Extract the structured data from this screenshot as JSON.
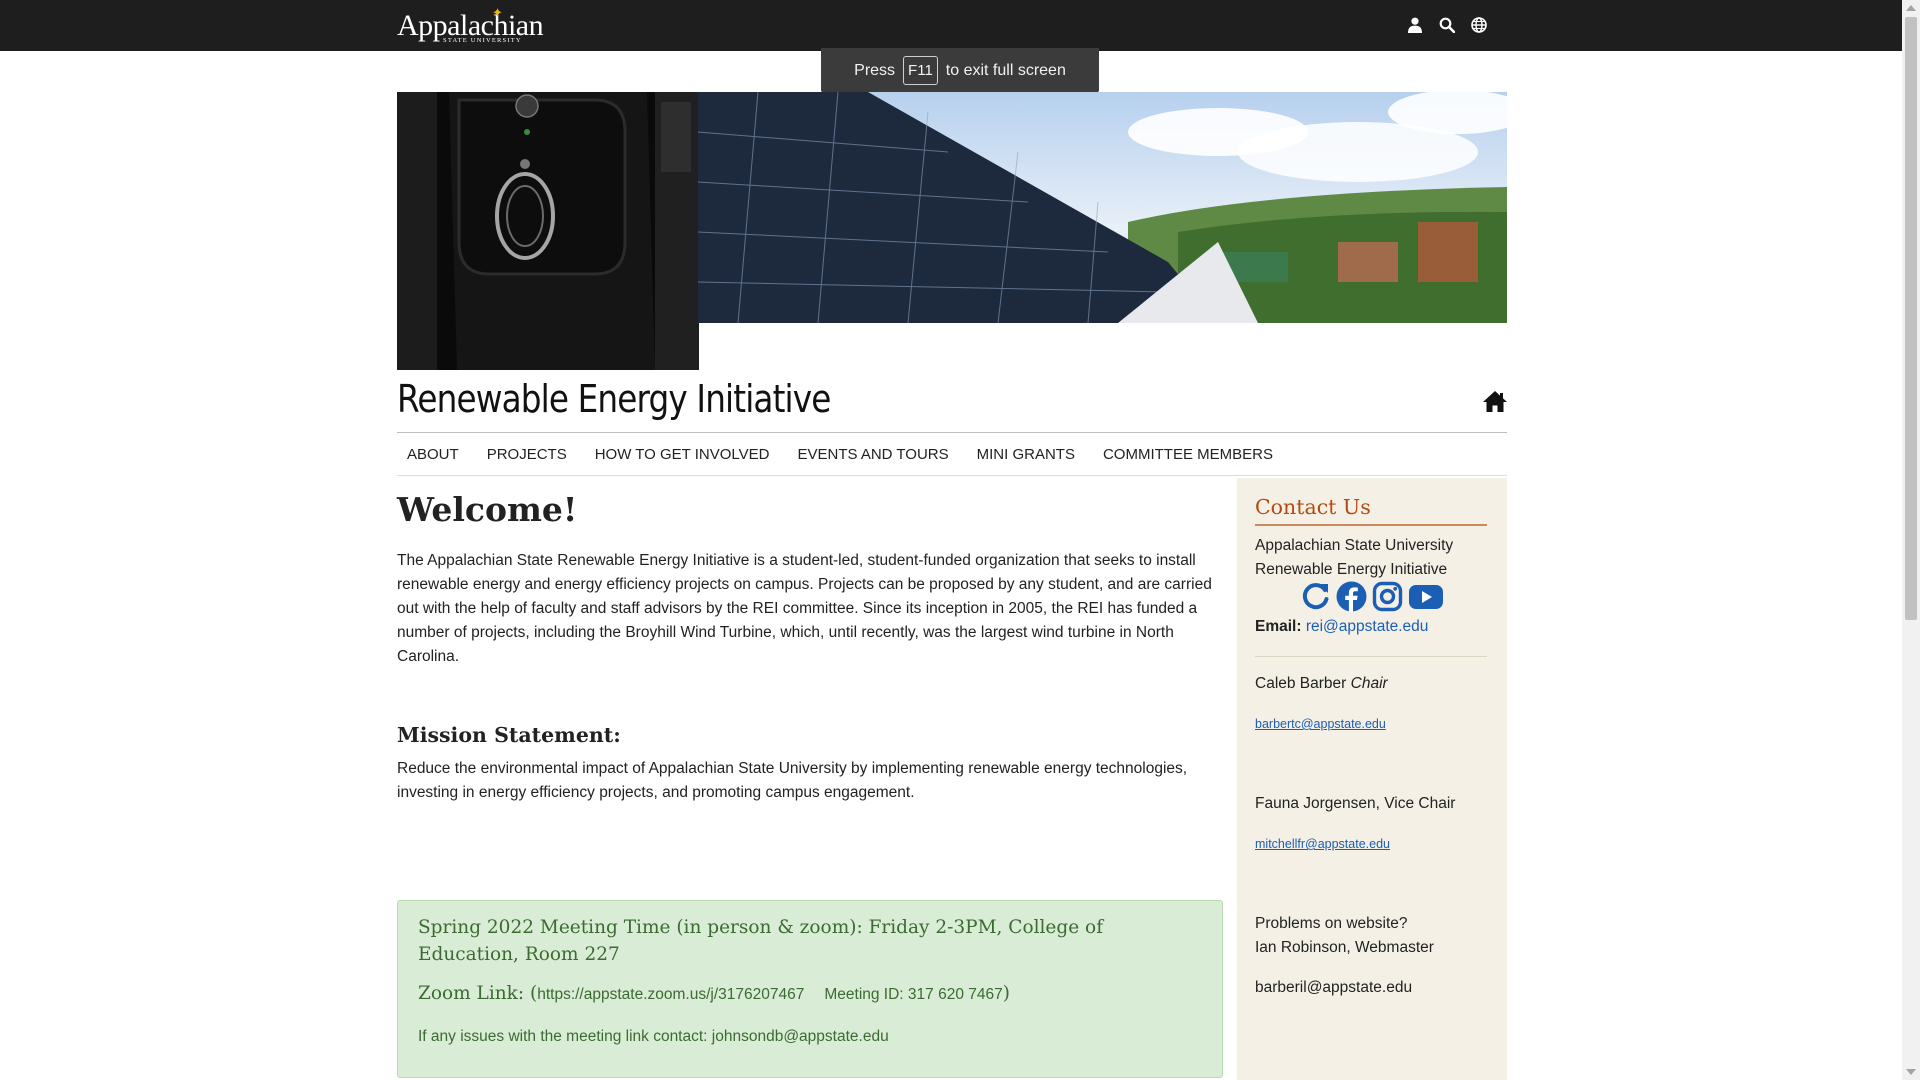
{
  "topbar": {
    "logo_text": "Appalachian",
    "logo_subtext": "STATE UNIVERSITY",
    "icons": [
      "user-icon",
      "search-icon",
      "globe-icon"
    ]
  },
  "fullscreen_notice": {
    "before": "Press",
    "key": "F11",
    "after": "to exit full screen"
  },
  "site": {
    "title": "Renewable Energy Initiative"
  },
  "nav": {
    "items": [
      "ABOUT",
      "PROJECTS",
      "HOW TO GET INVOLVED",
      "EVENTS AND TOURS",
      "MINI GRANTS",
      "COMMITTEE MEMBERS"
    ]
  },
  "main": {
    "welcome": "Welcome!",
    "intro": "The Appalachian State Renewable Energy Initiative is a student-led, student-funded organization that seeks to install renewable energy and energy efficiency projects on campus. Projects can be proposed by any student, and are carried out with the help of faculty and staff advisors by the REI committee. Since its inception in 2005, the REI has funded a number of projects, including the Broyhill Wind Turbine, which, until recently, was the largest wind turbine in North Carolina.",
    "mission_heading": "Mission Statement:",
    "mission_text": "Reduce the environmental impact of Appalachian State University by implementing renewable energy technologies, investing in energy efficiency projects, and promoting campus engagement."
  },
  "meeting": {
    "title": "Spring 2022 Meeting Time (in person & zoom): Friday 2-3PM, College of Education, Room 227",
    "zoom_label": "Zoom Link: (",
    "zoom_url": "https://appstate.zoom.us/j/3176207467",
    "meeting_id": "Meeting ID: 317 620 7467",
    "zoom_close": ")",
    "contact": "If any issues with the meeting link contact: johnsondb@appstate.edu"
  },
  "sidebar": {
    "heading": "Contact Us",
    "org_line1": "Appalachian State University",
    "org_line2": "Renewable Energy Initiative",
    "social_icons": [
      "refresh-icon",
      "facebook-icon",
      "instagram-icon",
      "youtube-icon"
    ],
    "email_label": "Email:",
    "email": "rei@appstate.edu",
    "chair_name": "Caleb Barber",
    "chair_role": "Chair",
    "chair_email": "barbertc@appstate.edu",
    "vice_chair": "Fauna Jorgensen, Vice Chair",
    "vice_chair_email": "mitchellfr@appstate.edu",
    "problems": "Problems on website?",
    "webmaster": "Ian Robinson, Webmaster",
    "webmaster_email": "barberil@appstate.edu"
  },
  "colors": {
    "topbar": "#1e1e1e",
    "accent_orange": "#b24a13",
    "link_blue": "#1a5fb4",
    "meeting_bg": "#d9ecd5",
    "meeting_text": "#3b6b32",
    "sidebar_bg": "#f4f0e6"
  }
}
